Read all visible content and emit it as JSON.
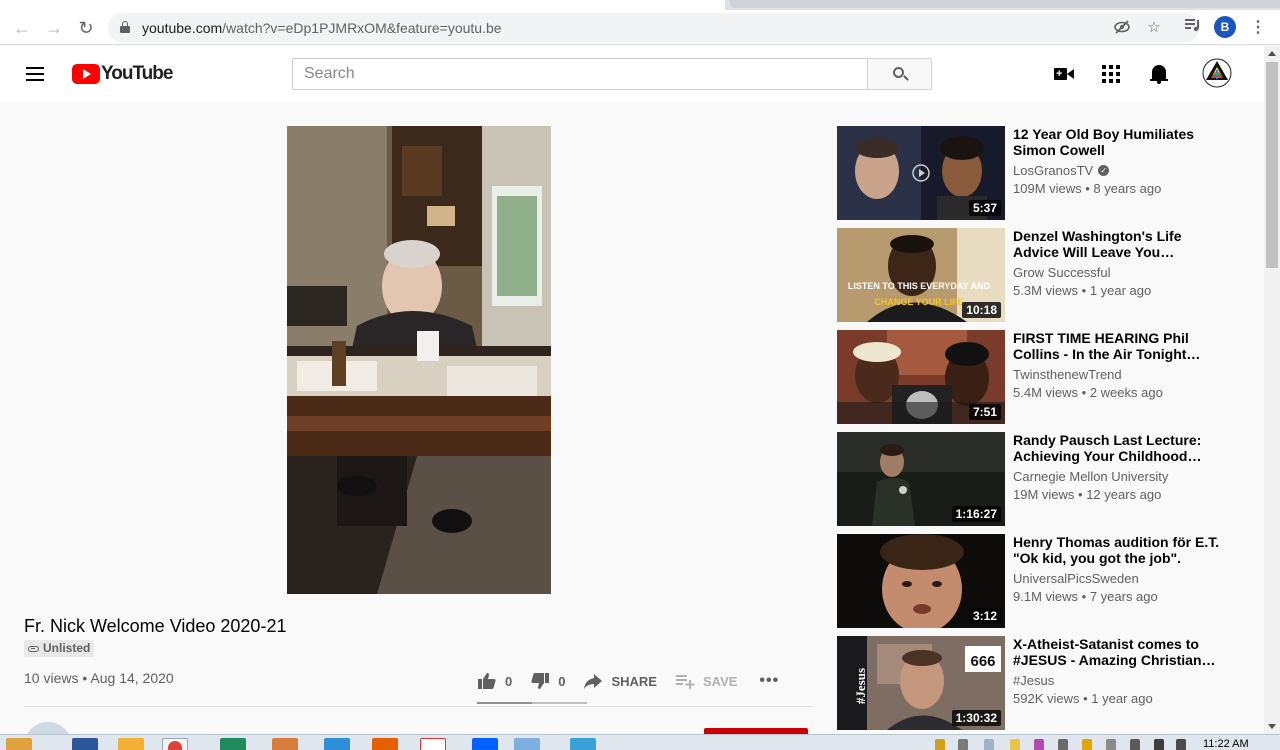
{
  "browser": {
    "url_domain": "youtube.com",
    "url_path": "/watch?v=eDp1PJMRxOM&feature=youtu.be",
    "profile_initial": "B",
    "icons": [
      "back-icon",
      "forward-icon",
      "reload-icon",
      "lock-icon",
      "eye-off-icon",
      "star-icon",
      "media-queue-icon",
      "menu-icon"
    ]
  },
  "youtube": {
    "logo_text": "YouTube",
    "search_placeholder": "Search",
    "header_icons": [
      "create-video-icon",
      "apps-icon",
      "notifications-icon"
    ]
  },
  "video": {
    "title": "Fr. Nick Welcome Video 2020-21",
    "visibility": "Unlisted",
    "views": "10 views",
    "date": "Aug 14, 2020",
    "likes": "0",
    "dislikes": "0",
    "like_ratio": 0.5,
    "share_label": "SHARE",
    "save_label": "SAVE",
    "more_label": "•••"
  },
  "recommendations": [
    {
      "title": "12 Year Old Boy Humiliates Simon Cowell",
      "channel": "LosGranosTV",
      "verified": true,
      "views": "109M views",
      "age": "8 years ago",
      "duration": "5:37"
    },
    {
      "title": "Denzel Washington's Life Advice Will Leave You SPEECHLESS (one of the most eye opening…",
      "channel": "Grow Successful",
      "verified": false,
      "views": "5.3M views",
      "age": "1 year ago",
      "duration": "10:18",
      "thumb_text_1": "LISTEN TO THIS EVERYDAY AND",
      "thumb_text_2": "CHANGE YOUR LIFE"
    },
    {
      "title": "FIRST TIME HEARING Phil Collins - In the Air Tonight (REACTION)",
      "channel": "TwinsthenewTrend",
      "verified": false,
      "views": "5.4M views",
      "age": "2 weeks ago",
      "duration": "7:51"
    },
    {
      "title": "Randy Pausch Last Lecture: Achieving Your Childhood Dreams",
      "channel": "Carnegie Mellon University",
      "verified": false,
      "views": "19M views",
      "age": "12 years ago",
      "duration": "1:16:27"
    },
    {
      "title": "Henry Thomas audition för E.T. \"Ok kid, you got the job\".",
      "channel": "UniversalPicsSweden",
      "verified": false,
      "views": "9.1M views",
      "age": "7 years ago",
      "duration": "3:12"
    },
    {
      "title": "X-Atheist-Satanist comes to #JESUS - Amazing Christian Testimony",
      "channel": "#Jesus",
      "verified": false,
      "views": "592K views",
      "age": "1 year ago",
      "duration": "1:30:32",
      "thumb_text_1": "#Jesus",
      "thumb_text_2": "666"
    }
  ],
  "taskbar": {
    "clock": "11:22 AM"
  },
  "colors": {
    "youtube_red": "#ff0000",
    "page_bg": "#f9f9f9",
    "text_secondary": "#606060"
  }
}
